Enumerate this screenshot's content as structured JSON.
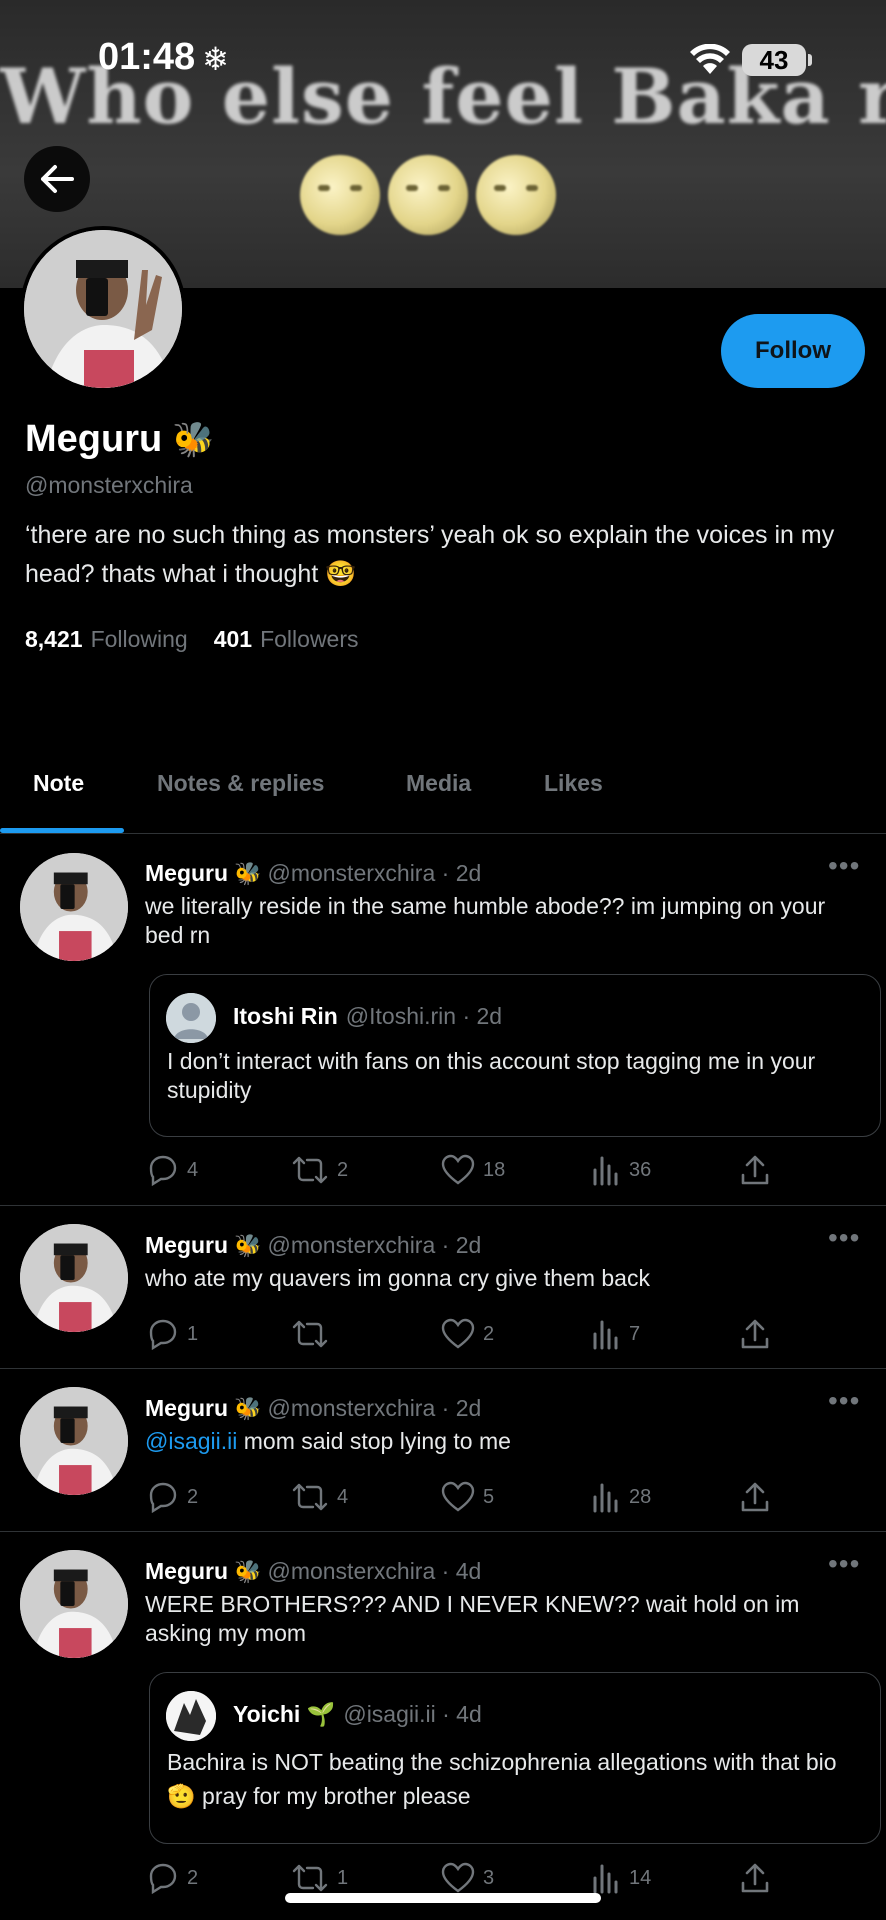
{
  "status": {
    "time": "01:48",
    "battery": "43"
  },
  "banner": {
    "text": "Who else feel Baka rn"
  },
  "profile": {
    "name": "Meguru",
    "handle": "@monsterxchira",
    "bio": "‘there are no such thing as monsters’ yeah ok so explain the voices in my head? thats what i thought 🤓",
    "following_count": "8,421",
    "following_label": "Following",
    "followers_count": "401",
    "followers_label": "Followers",
    "follow_label": "Follow"
  },
  "tabs": [
    {
      "label": "Note"
    },
    {
      "label": "Notes & replies"
    },
    {
      "label": "Media"
    },
    {
      "label": "Likes"
    }
  ],
  "posts": [
    {
      "name": "Meguru",
      "meta": "@monsterxchira · 2d",
      "text": "we literally reside in the same humble abode?? im jumping on your bed rn",
      "quote": {
        "name": "Itoshi Rin",
        "meta": "@Itoshi.rin · 2d",
        "text": "I don’t interact with fans on this account stop tagging me in your stupidity"
      },
      "replies": "4",
      "reposts": "2",
      "likes": "18",
      "views": "36"
    },
    {
      "name": "Meguru",
      "meta": "@monsterxchira · 2d",
      "text": "who ate my quavers im gonna cry give them back",
      "replies": "1",
      "reposts": "",
      "likes": "2",
      "views": "7"
    },
    {
      "name": "Meguru",
      "meta": "@monsterxchira · 2d",
      "mention": "@isagii.ii",
      "text": " mom said stop lying to me",
      "replies": "2",
      "reposts": "4",
      "likes": "5",
      "views": "28"
    },
    {
      "name": "Meguru",
      "meta": "@monsterxchira · 4d",
      "text": "WERE BROTHERS??? AND I NEVER KNEW?? wait hold on im asking my mom",
      "quote": {
        "name": "Yoichi 🌱",
        "meta": "@isagii.ii · 4d",
        "text": "Bachira is NOT beating the schizophrenia allegations with that bio 🫡 pray for my brother please"
      },
      "replies": "2",
      "reposts": "1",
      "likes": "3",
      "views": "14"
    }
  ],
  "icons": {
    "back": "arrow-left-icon",
    "reply": "reply-icon",
    "repost": "repost-icon",
    "like": "heart-icon",
    "views": "views-icon",
    "share": "share-icon",
    "more": "more-icon"
  },
  "colors": {
    "accent": "#1d9bf0",
    "muted": "#71767b",
    "background": "#000000"
  }
}
